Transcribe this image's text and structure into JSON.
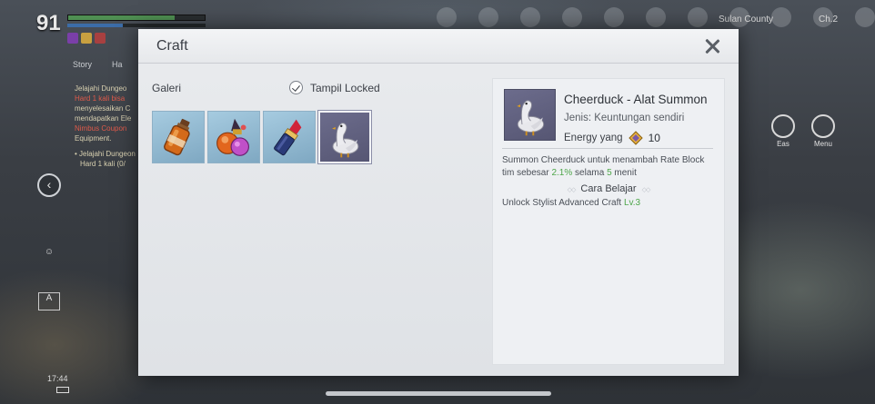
{
  "hud": {
    "level": "91",
    "tabs": [
      "Story",
      "Ha"
    ],
    "quest_lines": [
      "Jelajahi Dungeo",
      "Hard 1 kali bisa",
      "menyelesaikan C",
      "mendapatkan Ele",
      "Nimbus Coupon",
      "Equipment."
    ],
    "quest_bullet": "• Jelajahi Dungeon",
    "quest_bullet2": "Hard 1 kali (0/",
    "clock": "17:44",
    "location": "Sulan County",
    "channel": "Ch.2",
    "side_labels": {
      "eas": "Eas",
      "menu": "Menu"
    }
  },
  "modal": {
    "title": "Craft",
    "galeri_label": "Galeri",
    "show_locked_label": "Tampil Locked",
    "show_locked_checked": true,
    "items": [
      {
        "icon": "potion-bottle-icon"
      },
      {
        "icon": "perfume-flask-icon"
      },
      {
        "icon": "lipstick-icon"
      },
      {
        "icon": "cheerduck-icon",
        "selected": true
      }
    ]
  },
  "detail": {
    "name": "Cheerduck - Alat Summon",
    "type": "Jenis: Keuntungan sendiri",
    "energy_label": "Energy yang",
    "energy_value": "10",
    "desc_part1": "Summon Cheerduck untuk menambah Rate Block",
    "desc_part2": "tim sebesar ",
    "desc_rate": "2.1%",
    "desc_part3": " selama ",
    "desc_minutes": "5",
    "desc_part4": " menit",
    "learn_title": "Cara Belajar",
    "learn_text": "Unlock Stylist Advanced Craft ",
    "learn_level": "Lv.3"
  },
  "colors": {
    "accent_green": "#4ea64a",
    "slot_blue": "#a6cbe0",
    "slot_selected": "#6c6c8c"
  }
}
